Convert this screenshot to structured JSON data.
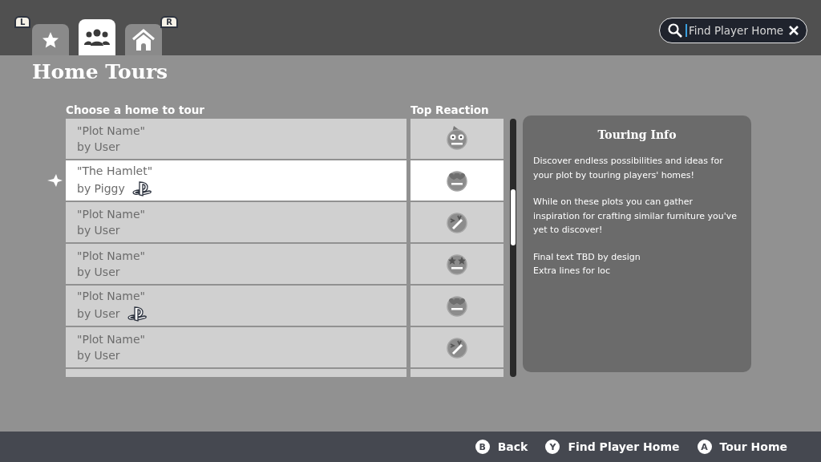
{
  "tabs": [
    {
      "kind": "star",
      "selected": false
    },
    {
      "kind": "people",
      "selected": true
    },
    {
      "kind": "house",
      "selected": false
    }
  ],
  "bumpers": [
    "L",
    "R"
  ],
  "search": {
    "placeholder": "Find Player Home"
  },
  "title": "Home Tours",
  "list": {
    "heading": "Choose a home to tour",
    "reaction_heading": "Top Reaction",
    "rows": [
      {
        "name": "\"Plot Name\"",
        "owner": "by User",
        "platform": false,
        "reaction": {
          "kind": "wizard"
        },
        "selected": false
      },
      {
        "name": "\"The Hamlet\"",
        "owner": "by Piggy",
        "platform": true,
        "reaction": {
          "kind": "heart-eyes"
        },
        "selected": true
      },
      {
        "name": "\"Plot Name\"",
        "owner": "by User",
        "platform": false,
        "reaction": {
          "kind": "laughing"
        },
        "selected": false
      },
      {
        "name": "\"Plot Name\"",
        "owner": "by User",
        "platform": false,
        "reaction": {
          "kind": "star-eyes"
        },
        "selected": false
      },
      {
        "name": "\"Plot Name\"",
        "owner": "by User",
        "platform": true,
        "reaction": {
          "kind": "heart-eyes"
        },
        "selected": false
      },
      {
        "name": "\"Plot Name\"",
        "owner": "by User",
        "platform": false,
        "reaction": {
          "kind": "laughing"
        },
        "selected": false
      }
    ]
  },
  "info": {
    "title": "Touring Info",
    "paragraphs": [
      "Discover endless possibilities and ideas for your plot by touring players' homes!",
      "While on these plots you can gather inspiration for crafting similar furniture you've yet to discover!",
      "Final text TBD by design\nExtra lines for loc"
    ]
  },
  "footer": [
    {
      "key": "B",
      "label": "Back"
    },
    {
      "key": "Y",
      "label": "Find Player Home"
    },
    {
      "key": "A",
      "label": "Tour Home"
    }
  ]
}
